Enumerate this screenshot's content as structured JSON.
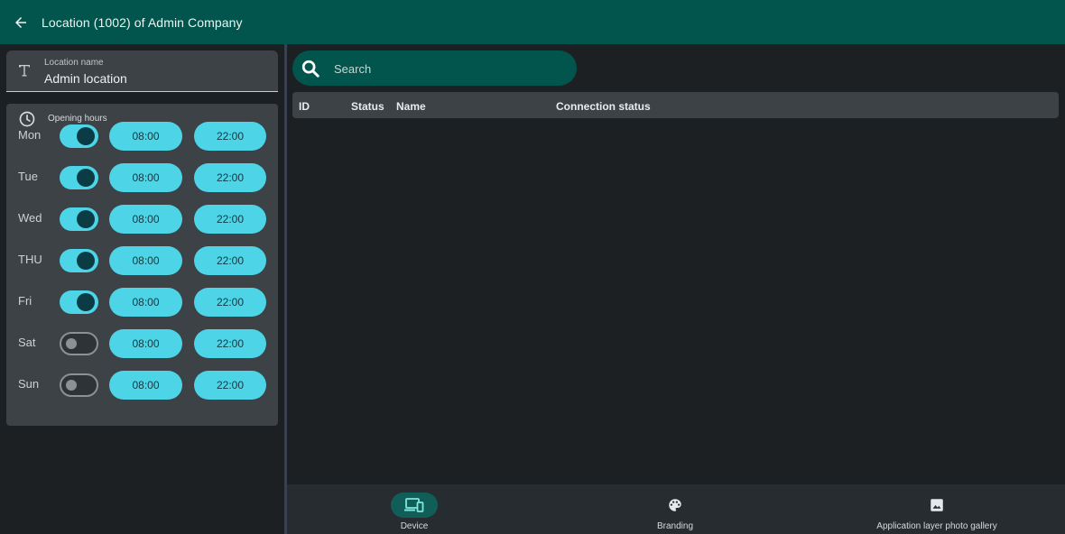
{
  "header": {
    "title": "Location (1002) of  Admin Company"
  },
  "location_field": {
    "label": "Location name",
    "value": "Admin location"
  },
  "opening_hours": {
    "title": "Opening hours",
    "days": [
      {
        "day": "Mon",
        "enabled": true,
        "open": "08:00",
        "close": "22:00"
      },
      {
        "day": "Tue",
        "enabled": true,
        "open": "08:00",
        "close": "22:00"
      },
      {
        "day": "Wed",
        "enabled": true,
        "open": "08:00",
        "close": "22:00"
      },
      {
        "day": "THU",
        "enabled": true,
        "open": "08:00",
        "close": "22:00"
      },
      {
        "day": "Fri",
        "enabled": true,
        "open": "08:00",
        "close": "22:00"
      },
      {
        "day": "Sat",
        "enabled": false,
        "open": "08:00",
        "close": "22:00"
      },
      {
        "day": "Sun",
        "enabled": false,
        "open": "08:00",
        "close": "22:00"
      }
    ]
  },
  "search": {
    "placeholder": "Search"
  },
  "table": {
    "columns": [
      "ID",
      "Status",
      "Name",
      "Connection status"
    ]
  },
  "bottom_nav": {
    "items": [
      {
        "label": "Device",
        "icon": "devices-icon",
        "active": true
      },
      {
        "label": "Branding",
        "icon": "palette-icon",
        "active": false
      },
      {
        "label": "Application layer photo gallery",
        "icon": "image-icon",
        "active": false
      }
    ]
  },
  "colors": {
    "primary": "#02554c",
    "accent": "#4dd4e6",
    "surface": "#3c4245",
    "background": "#1d2022"
  }
}
